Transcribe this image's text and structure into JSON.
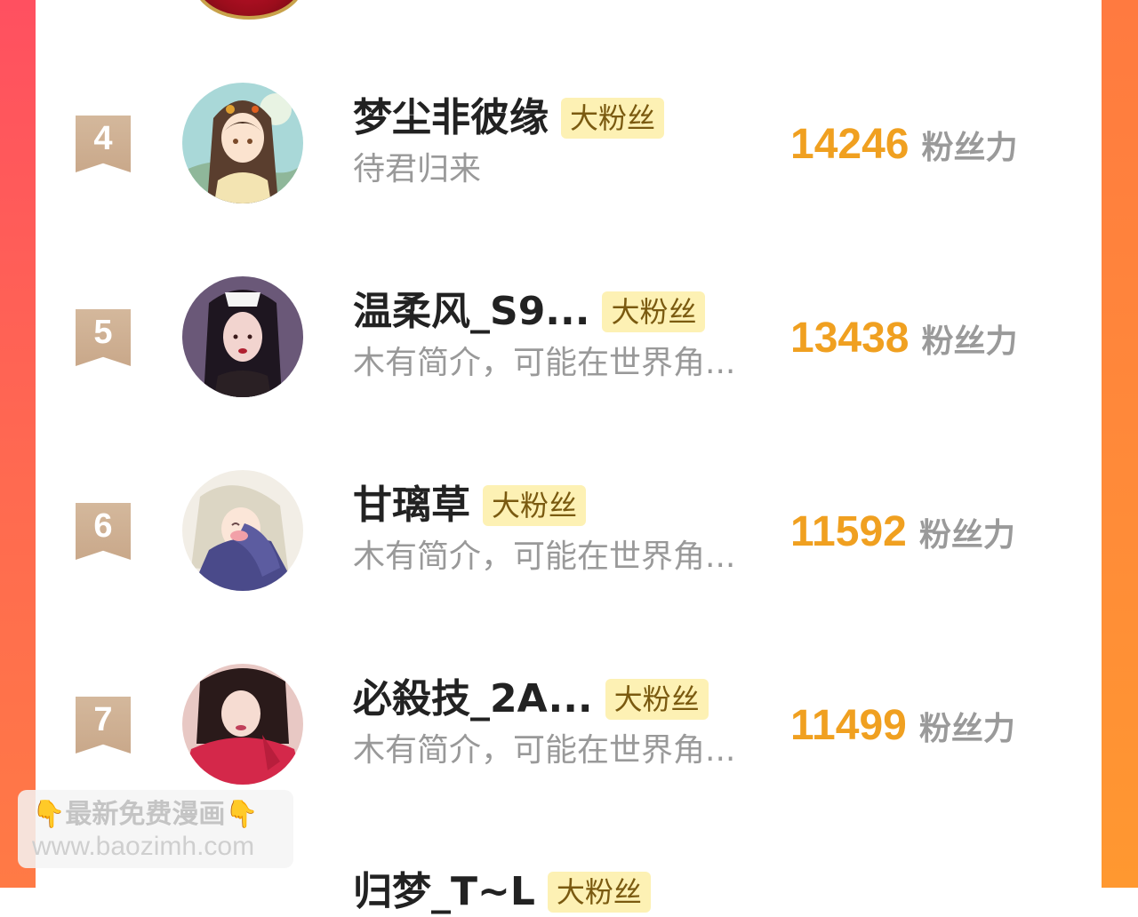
{
  "leaderboard": {
    "entries": [
      {
        "rank": "4",
        "name": "梦尘非彼缘",
        "badge": "大粉丝",
        "bio": "待君归来",
        "score": "14246",
        "score_unit": "粉丝力",
        "avatar": "avatar-anime-girl-updo"
      },
      {
        "rank": "5",
        "name": "温柔风_S9...",
        "badge": "大粉丝",
        "bio": "木有简介，可能在世界角...",
        "score": "13438",
        "score_unit": "粉丝力",
        "avatar": "avatar-girl-fox-mask"
      },
      {
        "rank": "6",
        "name": "甘璃草",
        "badge": "大粉丝",
        "bio": "木有简介，可能在世界角...",
        "score": "11592",
        "score_unit": "粉丝力",
        "avatar": "avatar-anime-hug"
      },
      {
        "rank": "7",
        "name": "必殺技_2A...",
        "badge": "大粉丝",
        "bio": "木有简介，可能在世界角...",
        "score": "11499",
        "score_unit": "粉丝力",
        "avatar": "avatar-girl-red-hoodie"
      }
    ],
    "partial_entry": {
      "name": "归梦_T~L",
      "badge": "大粉丝"
    }
  },
  "watermark": {
    "hand_icon": "👇",
    "line1": "最新免费漫画",
    "line2": "www.baozimh.com"
  },
  "colors": {
    "frame_left": "#ff5a5a",
    "frame_right": "#ff8c38",
    "score": "#f0a020",
    "badge_bg": "#fdf1b4",
    "rank_flag": "#d0b293"
  }
}
